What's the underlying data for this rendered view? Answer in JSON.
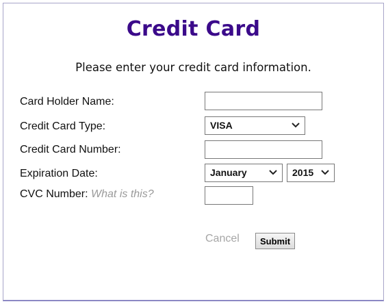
{
  "form": {
    "title": "Credit Card",
    "instructions": "Please enter your credit card information.",
    "fields": {
      "holder_name": {
        "label": "Card Holder Name:",
        "value": ""
      },
      "card_type": {
        "label": "Credit Card Type:",
        "selected": "VISA"
      },
      "card_number": {
        "label": "Credit Card Number:",
        "value": ""
      },
      "expiration": {
        "label": "Expiration Date:",
        "month": "January",
        "year": "2015"
      },
      "cvc": {
        "label": "CVC Number:",
        "help_link": "What is this?",
        "value": ""
      }
    },
    "actions": {
      "cancel_label": "Cancel",
      "submit_label": "Submit"
    }
  },
  "icons": {
    "dropdown": "chevron-down-icon"
  },
  "colors": {
    "title": "#3b0a8a",
    "border": "#8c88c4",
    "hint": "#9a9a9a"
  }
}
